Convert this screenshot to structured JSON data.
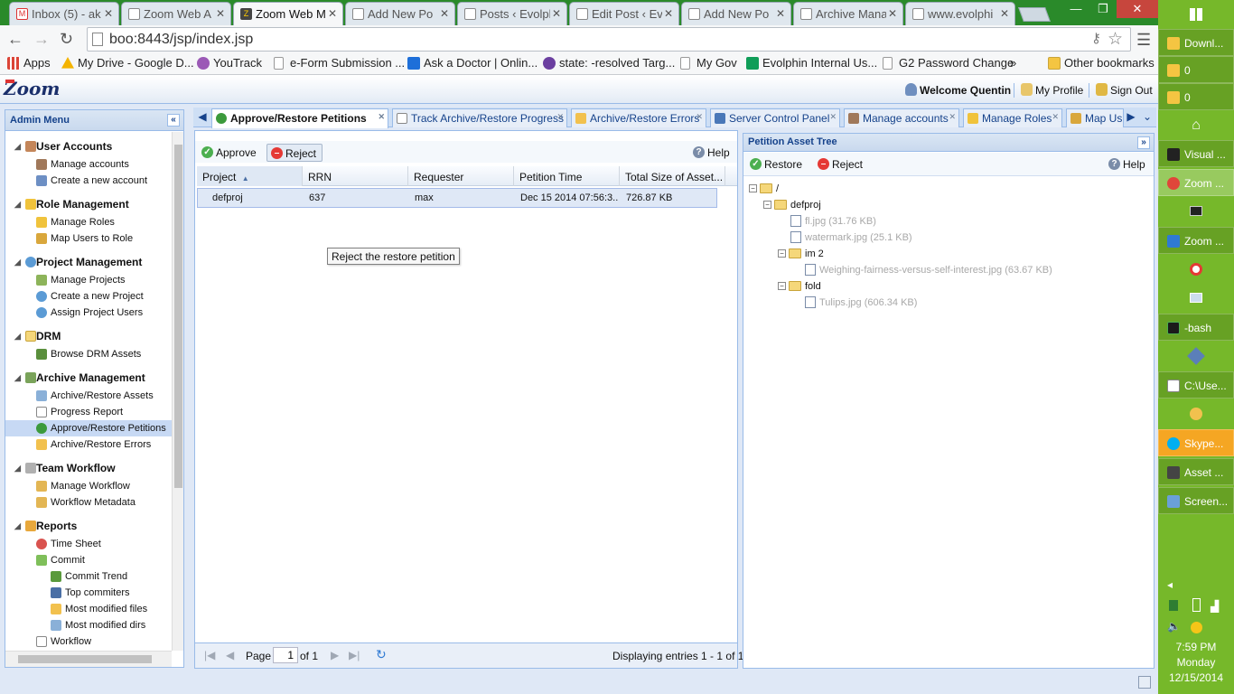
{
  "browser": {
    "tabs": [
      {
        "label": "Inbox (5) - ak",
        "icon": "gmail-icon"
      },
      {
        "label": "Zoom Web A",
        "icon": "page-icon"
      },
      {
        "label": "Zoom Web M",
        "icon": "zoom-icon",
        "active": true
      },
      {
        "label": "Add New Po",
        "icon": "page-icon"
      },
      {
        "label": "Posts ‹ Evolpl",
        "icon": "page-icon"
      },
      {
        "label": "Edit Post ‹ Ev",
        "icon": "page-icon"
      },
      {
        "label": "Add New Po",
        "icon": "page-icon"
      },
      {
        "label": "Archive Mana",
        "icon": "page-icon"
      },
      {
        "label": "www.evolphi",
        "icon": "page-icon"
      }
    ],
    "url": "boo:8443/jsp/index.jsp",
    "bookmarks": [
      {
        "label": "Apps",
        "color": "#db4437"
      },
      {
        "label": "My Drive - Google D...",
        "color": "#f4b400"
      },
      {
        "label": "YouTrack",
        "color": "#9b59b6"
      },
      {
        "label": "e-Form Submission ...",
        "color": "#cccccc"
      },
      {
        "label": "Ask a Doctor | Onlin...",
        "color": "#1e6fd9"
      },
      {
        "label": "state: -resolved Targ...",
        "color": "#6b3fa0"
      },
      {
        "label": "My Gov",
        "color": "#cccccc"
      },
      {
        "label": "Evolphin Internal Us...",
        "color": "#0f9d58"
      },
      {
        "label": "G2 Password Change",
        "color": "#cccccc"
      },
      {
        "label": "»",
        "color": ""
      },
      {
        "label": "Other bookmarks",
        "color": "#f4c542"
      }
    ]
  },
  "app": {
    "logo": "Zoom",
    "header": {
      "welcome": "Welcome Quentin",
      "profile": "My Profile",
      "signout": "Sign Out"
    },
    "menu": {
      "title": "Admin Menu",
      "groups": [
        {
          "label": "User Accounts",
          "items": [
            "Manage accounts",
            "Create a new account"
          ]
        },
        {
          "label": "Role Management",
          "items": [
            "Manage Roles",
            "Map Users to Role"
          ]
        },
        {
          "label": "Project Management",
          "items": [
            "Manage Projects",
            "Create a new Project",
            "Assign Project Users"
          ]
        },
        {
          "label": "DRM",
          "items": [
            "Browse DRM Assets"
          ]
        },
        {
          "label": "Archive Management",
          "items": [
            "Archive/Restore Assets",
            "Progress Report",
            "Approve/Restore Petitions",
            "Archive/Restore Errors"
          ]
        },
        {
          "label": "Team Workflow",
          "items": [
            "Manage Workflow",
            "Workflow Metadata"
          ]
        },
        {
          "label": "Reports",
          "items": [
            "Time Sheet",
            "Commit",
            "Commit Trend",
            "Top commiters",
            "Most modified files",
            "Most modified dirs",
            "Workflow"
          ]
        }
      ]
    },
    "tabs": [
      "Approve/Restore Petitions",
      "Track Archive/Restore Progress",
      "Archive/Restore Errors",
      "Server Control Panel",
      "Manage accounts",
      "Manage Roles",
      "Map Us"
    ],
    "grid": {
      "approve": "Approve",
      "reject": "Reject",
      "help": "Help",
      "tooltip": "Reject the restore petition",
      "columns": [
        "Project",
        "RRN",
        "Requester",
        "Petition Time",
        "Total Size of Asset..."
      ],
      "rows": [
        {
          "project": "defproj",
          "rrn": "637",
          "requester": "max",
          "time": "Dec 15 2014 07:56:3...",
          "size": "726.87 KB"
        }
      ],
      "pager": {
        "page_label": "Page",
        "page_value": "1",
        "of_label": "of 1",
        "display": "Displaying entries 1 - 1 of 1"
      }
    },
    "tree": {
      "title": "Petition Asset Tree",
      "restore": "Restore",
      "reject": "Reject",
      "help": "Help",
      "nodes": [
        {
          "label": "/",
          "type": "folder"
        },
        {
          "label": "defproj",
          "type": "folder"
        },
        {
          "label": "fl.jpg (31.76 KB)",
          "type": "file"
        },
        {
          "label": "watermark.jpg (25.1 KB)",
          "type": "file"
        },
        {
          "label": "im 2",
          "type": "folder"
        },
        {
          "label": "Weighing-fairness-versus-self-interest.jpg (63.67 KB)",
          "type": "file"
        },
        {
          "label": "fold",
          "type": "folder"
        },
        {
          "label": "Tulips.jpg (606.34 KB)",
          "type": "file"
        }
      ]
    }
  },
  "taskbar": {
    "items": [
      "Downl...",
      "0",
      "0",
      "Visual ...",
      "Zoom ...",
      "Zoom ...",
      "-bash",
      "C:\\Use...",
      "Skype...",
      "Asset ...",
      "Screen..."
    ],
    "time": "7:59 PM",
    "day": "Monday",
    "date": "12/15/2014"
  }
}
